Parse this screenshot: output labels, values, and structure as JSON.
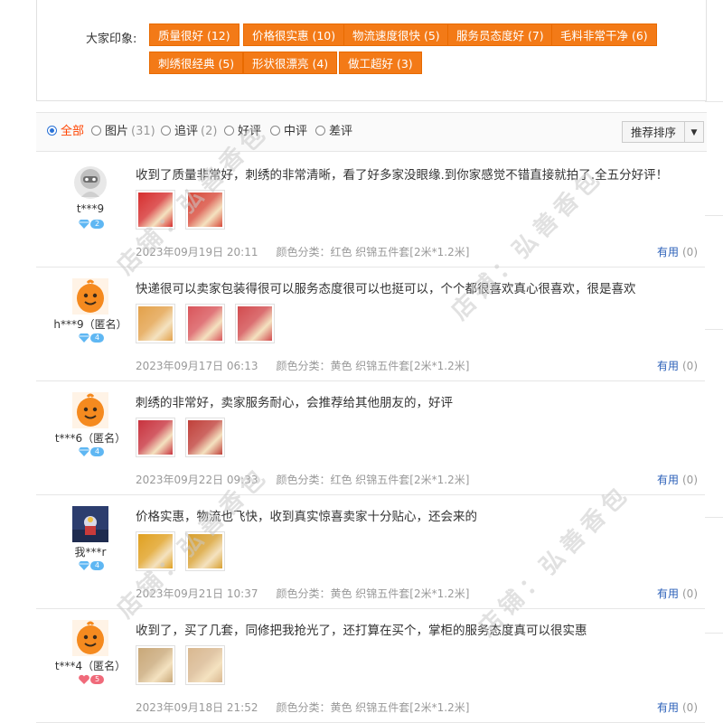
{
  "impressions": {
    "label": "大家印象:",
    "tags": [
      {
        "text": "质量很好 (12)"
      },
      {
        "text": "价格很实惠 (10)"
      },
      {
        "text": "物流速度很快 (5)"
      },
      {
        "text": "服务员态度好 (7)"
      },
      {
        "text": "毛料非常干净 (6)"
      },
      {
        "text": "刺绣很经典 (5)"
      },
      {
        "text": "形状很漂亮 (4)"
      },
      {
        "text": "做工超好 (3)"
      }
    ]
  },
  "filters": {
    "items": [
      {
        "label": "全部",
        "count": "",
        "checked": true
      },
      {
        "label": "图片",
        "count": "(31)",
        "checked": false
      },
      {
        "label": "追评",
        "count": "(2)",
        "checked": false
      },
      {
        "label": "好评",
        "count": "",
        "checked": false
      },
      {
        "label": "中评",
        "count": "",
        "checked": false
      },
      {
        "label": "差评",
        "count": "",
        "checked": false
      }
    ],
    "sort_label": "推荐排序",
    "sort_arrow": "▼"
  },
  "reviews": [
    {
      "user": "t***9",
      "level": "2",
      "level_color": "#5fb7f3",
      "level_icon": "diamond-icon",
      "avatar_type": "robot",
      "content": "收到了质量非常好，刺绣的非常清晰，看了好多家没眼缘.到你家感觉不错直接就拍了.全五分好评！",
      "photos": [
        "#d62f2f",
        "#d84a3a"
      ],
      "date": "2023年09月19日 20:11",
      "variant": "颜色分类：红色 织锦五件套[2米*1.2米]",
      "useful_label": "有用",
      "useful_count": "(0)"
    },
    {
      "user": "h***9（匿名）",
      "level": "4",
      "level_color": "#5fb7f3",
      "level_icon": "diamond-icon",
      "avatar_type": "orange",
      "content": "快递很可以卖家包装得很可以服务态度很可以也挺可以，个个都很喜欢真心很喜欢，很是喜欢",
      "photos": [
        "#e3a14a",
        "#d9555a",
        "#d24b4e"
      ],
      "date": "2023年09月17日 06:13",
      "variant": "颜色分类：黄色 织锦五件套[2米*1.2米]",
      "useful_label": "有用",
      "useful_count": "(0)"
    },
    {
      "user": "t***6（匿名）",
      "level": "4",
      "level_color": "#5fb7f3",
      "level_icon": "diamond-icon",
      "avatar_type": "orange",
      "content": "刺绣的非常好，卖家服务耐心，会推荐给其他朋友的，好评",
      "photos": [
        "#c8333e",
        "#c0403a"
      ],
      "date": "2023年09月22日 09:33",
      "variant": "颜色分类：红色 织锦五件套[2米*1.2米]",
      "useful_label": "有用",
      "useful_count": "(0)"
    },
    {
      "user": "我***r",
      "level": "4",
      "level_color": "#5fb7f3",
      "level_icon": "diamond-icon",
      "avatar_type": "photo",
      "content": "价格实惠，物流也飞快，收到真实惊喜卖家十分贴心，还会来的",
      "photos": [
        "#e0a020",
        "#d8a030"
      ],
      "date": "2023年09月21日 10:37",
      "variant": "颜色分类：黄色 织锦五件套[2米*1.2米]",
      "useful_label": "有用",
      "useful_count": "(0)"
    },
    {
      "user": "t***4（匿名）",
      "level": "5",
      "level_color": "#f06a7a",
      "level_icon": "heart-icon",
      "avatar_type": "orange",
      "content": "收到了，买了几套，同修把我抢光了，还打算在买个，掌柜的服务态度真可以很实惠",
      "photos": [
        "#c9a878",
        "#d9b890"
      ],
      "date": "2023年09月18日 21:52",
      "variant": "颜色分类：黄色 织锦五件套[2米*1.2米]",
      "useful_label": "有用",
      "useful_count": "(0)"
    }
  ],
  "watermark": "店铺：弘善香包"
}
